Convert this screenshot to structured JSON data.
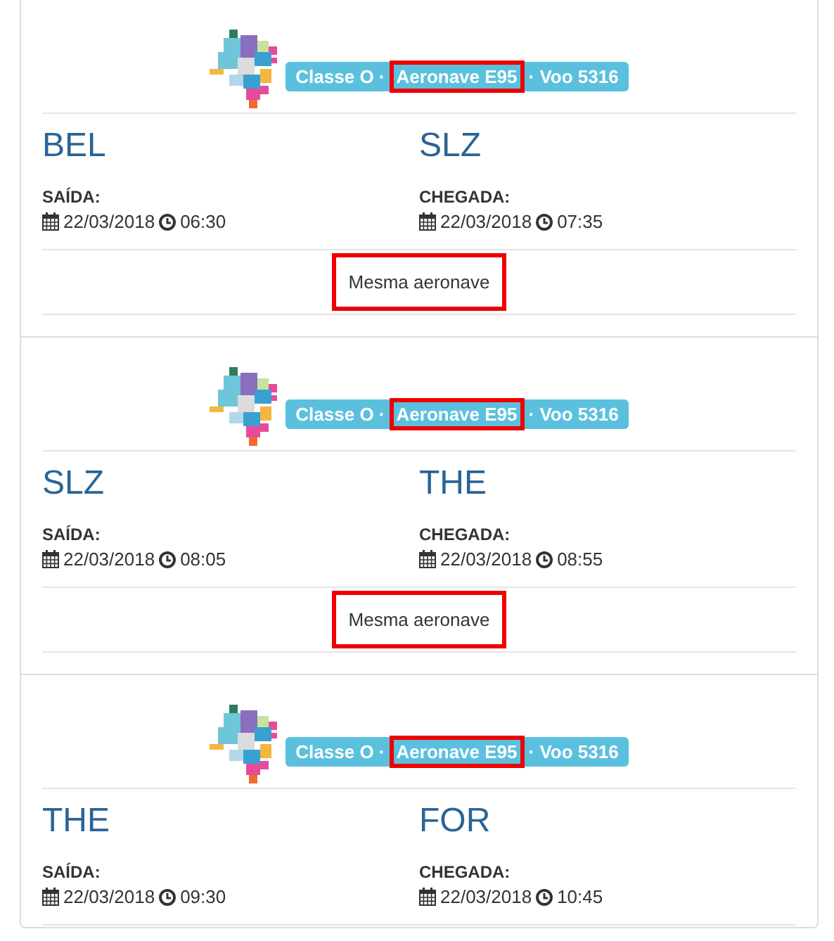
{
  "legs": [
    {
      "badge": [
        {
          "text": "Classe O ·",
          "highlighted": false
        },
        {
          "text": "Aeronave E95",
          "highlighted": true
        },
        {
          "text": "· Voo 5316",
          "highlighted": false
        }
      ],
      "origin": {
        "code": "BEL",
        "label": "SAÍDA:",
        "date": "22/03/2018",
        "time": "06:30"
      },
      "destination": {
        "code": "SLZ",
        "label": "CHEGADA:",
        "date": "22/03/2018",
        "time": "07:35"
      },
      "note": {
        "text": "Mesma aeronave",
        "highlighted": true
      }
    },
    {
      "badge": [
        {
          "text": "Classe O ·",
          "highlighted": false
        },
        {
          "text": "Aeronave E95",
          "highlighted": true
        },
        {
          "text": "· Voo 5316",
          "highlighted": false
        }
      ],
      "origin": {
        "code": "SLZ",
        "label": "SAÍDA:",
        "date": "22/03/2018",
        "time": "08:05"
      },
      "destination": {
        "code": "THE",
        "label": "CHEGADA:",
        "date": "22/03/2018",
        "time": "08:55"
      },
      "note": {
        "text": "Mesma aeronave",
        "highlighted": true
      }
    },
    {
      "badge": [
        {
          "text": "Classe O ·",
          "highlighted": false
        },
        {
          "text": "Aeronave E95",
          "highlighted": true
        },
        {
          "text": "· Voo 5316",
          "highlighted": false
        }
      ],
      "origin": {
        "code": "THE",
        "label": "SAÍDA:",
        "date": "22/03/2018",
        "time": "09:30"
      },
      "destination": {
        "code": "FOR",
        "label": "CHEGADA:",
        "date": "22/03/2018",
        "time": "10:45"
      }
    }
  ]
}
